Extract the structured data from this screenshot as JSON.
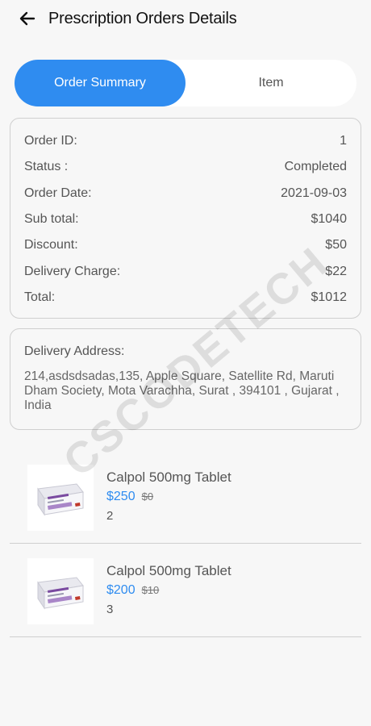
{
  "header": {
    "title": "Prescription Orders Details",
    "back_icon": "arrow-left-icon"
  },
  "tabs": [
    {
      "label": "Order Summary",
      "active": true
    },
    {
      "label": "Item",
      "active": false
    }
  ],
  "summary": {
    "rows": [
      {
        "label": "Order ID:",
        "value": "1"
      },
      {
        "label": "Status :",
        "value": "Completed"
      },
      {
        "label": "Order Date:",
        "value": "2021-09-03"
      },
      {
        "label": "Sub total:",
        "value": "$1040"
      },
      {
        "label": "Discount:",
        "value": "$50"
      },
      {
        "label": "Delivery Charge:",
        "value": "$22"
      },
      {
        "label": "Total:",
        "value": "$1012"
      }
    ]
  },
  "address": {
    "label": "Delivery Address:",
    "text": "214,asdsdsadas,135, Apple Square, Satellite Rd, Maruti Dham Society, Mota Varachha,  Surat , 394101 , Gujarat , India"
  },
  "items": [
    {
      "name": "Calpol 500mg Tablet",
      "price": "$250",
      "old_price": "$0",
      "qty": "2",
      "image_icon": "medicine-box-icon"
    },
    {
      "name": "Calpol 500mg Tablet",
      "price": "$200",
      "old_price": "$10",
      "qty": "3",
      "image_icon": "medicine-box-icon"
    }
  ],
  "watermark": "CSCODETECH",
  "colors": {
    "accent": "#2f8cf0",
    "background": "#f7f7f7"
  }
}
